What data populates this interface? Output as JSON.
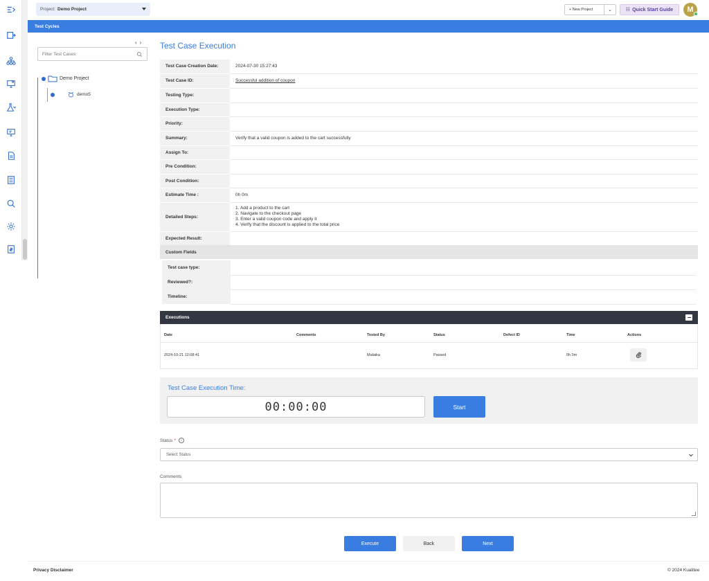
{
  "header": {
    "project_label": "Project:",
    "project_value": "Demo Project",
    "new_project_label": "+ New Project",
    "quick_start_label": "Quick Start Guide",
    "avatar_initial": "M"
  },
  "section_bar": {
    "title": "Test Cycles"
  },
  "tree": {
    "nav_prev": "‹",
    "nav_next": "›",
    "filter_placeholder": "Filter Test Cases",
    "root_label": "Demo Project",
    "child_label": "demo5"
  },
  "main": {
    "title": "Test Case Execution",
    "fields": [
      {
        "label": "Test Case Creation Date:",
        "value": "2024-07-30 15:27:43"
      },
      {
        "label": "Test Case ID:",
        "value": "Successful addition of coupon"
      },
      {
        "label": "Testing Type:",
        "value": ""
      },
      {
        "label": "Execution Type:",
        "value": ""
      },
      {
        "label": "Priority:",
        "value": ""
      },
      {
        "label": "Summary:",
        "value": "Verify that a valid coupon is added to the cart successfully"
      },
      {
        "label": "Assign To:",
        "value": ""
      },
      {
        "label": "Pre Condition:",
        "value": ""
      },
      {
        "label": "Post Condition:",
        "value": ""
      },
      {
        "label": "Estimate Time :",
        "value": "0h 0m"
      },
      {
        "label": "Detailed Steps:",
        "value": ""
      },
      {
        "label": "Expected Result:",
        "value": ""
      }
    ],
    "detailed_steps": [
      "1. Add a product to the cart",
      "2. Navigate to the checkout page",
      "3. Enter a valid coupon code and apply it",
      "4. Verify that the discount is applied to the total price"
    ],
    "custom_fields_title": "Custom Fields",
    "custom_fields": [
      {
        "label": "Test case type:"
      },
      {
        "label": "Reviewed?:"
      },
      {
        "label": "Timeline:"
      }
    ]
  },
  "executions": {
    "title": "Executions",
    "columns": [
      "Date",
      "Comments",
      "Tested By",
      "Status",
      "Defect ID",
      "Time",
      "Actions"
    ],
    "rows": [
      {
        "date": "2024-10-21 12:08:41",
        "comments": "",
        "tested_by": "Malaika",
        "status": "Passed",
        "defect_id": "",
        "time": "0h 0m"
      }
    ]
  },
  "timer": {
    "title": "Test Case Execution Time:",
    "value": "00:00:00",
    "start_label": "Start"
  },
  "form": {
    "status_label": "Status",
    "status_required": "*",
    "status_placeholder": "Select Status",
    "comments_label": "Comments"
  },
  "actions": {
    "execute_label": "Execute",
    "back_label": "Back",
    "next_label": "Next"
  },
  "footer": {
    "privacy": "Privacy Disclaimer",
    "copyright": "© 2024 Kualitee"
  },
  "colors": {
    "accent": "#3a7de0",
    "dark_header": "#333742",
    "quick_start_bg": "#ece3f6"
  }
}
